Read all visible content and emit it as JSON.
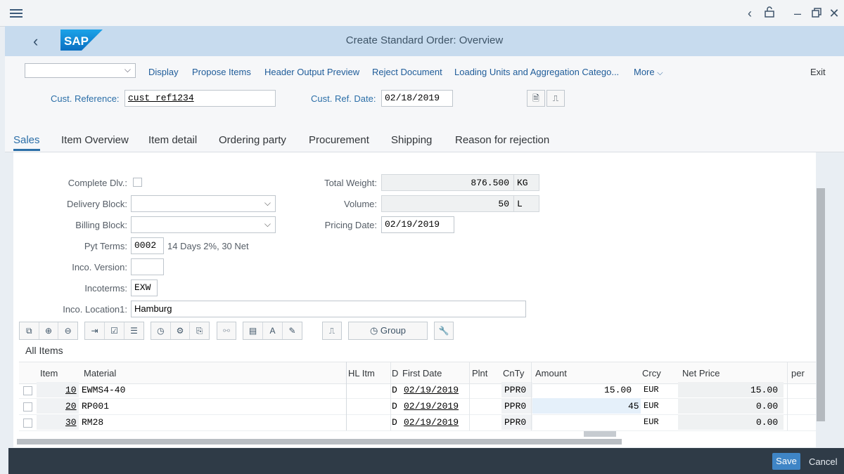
{
  "header": {
    "title": "Create Standard Order: Overview"
  },
  "toolbar": {
    "variant_value": "",
    "buttons": [
      "Display",
      "Propose Items",
      "Header Output Preview",
      "Reject Document",
      "Loading Units and Aggregation Catego...",
      "More"
    ],
    "exit": "Exit"
  },
  "reference": {
    "cust_ref_label": "Cust. Reference:",
    "cust_ref_value": "cust_ref1234",
    "cust_ref_date_label": "Cust. Ref. Date:",
    "cust_ref_date_value": "02/18/2019"
  },
  "tabs": [
    "Sales",
    "Item Overview",
    "Item detail",
    "Ordering party",
    "Procurement",
    "Shipping",
    "Reason for rejection"
  ],
  "sales": {
    "complete_dlv_label": "Complete Dlv.:",
    "delivery_block_label": "Delivery Block:",
    "delivery_block_value": "",
    "billing_block_label": "Billing Block:",
    "billing_block_value": "",
    "pyt_terms_label": "Pyt Terms:",
    "pyt_terms_value": "0002",
    "pyt_terms_desc": "14 Days 2%, 30 Net",
    "inco_version_label": "Inco. Version:",
    "inco_version_value": "",
    "incoterms_label": "Incoterms:",
    "incoterms_value": "EXW",
    "inco_location_label": "Inco. Location1:",
    "inco_location_value": "Hamburg",
    "total_weight_label": "Total Weight:",
    "total_weight_value": "876.500",
    "total_weight_unit": "KG",
    "volume_label": "Volume:",
    "volume_value": "50",
    "volume_unit": "L",
    "pricing_date_label": "Pricing Date:",
    "pricing_date_value": "02/19/2019"
  },
  "items_toolbar": {
    "group_label": "Group"
  },
  "items": {
    "title": "All Items",
    "columns": [
      "Item",
      "Material",
      "HL Itm",
      "D",
      "First Date",
      "Plnt",
      "CnTy",
      "Amount",
      "Crcy",
      "Net Price",
      "per"
    ],
    "rows": [
      {
        "item": "10",
        "material": "EWMS4-40",
        "hl_itm": "",
        "d": "D",
        "first_date": "02/19/2019",
        "plnt": "",
        "cnty": "PPR0",
        "amount": "15.00",
        "crcy": "EUR",
        "net_price": "15.00",
        "per": ""
      },
      {
        "item": "20",
        "material": "RP001",
        "hl_itm": "",
        "d": "D",
        "first_date": "02/19/2019",
        "plnt": "",
        "cnty": "PPR0",
        "amount": "45",
        "crcy": "EUR",
        "net_price": "0.00",
        "per": ""
      },
      {
        "item": "30",
        "material": "RM28",
        "hl_itm": "",
        "d": "D",
        "first_date": "02/19/2019",
        "plnt": "",
        "cnty": "PPR0",
        "amount": "",
        "crcy": "EUR",
        "net_price": "0.00",
        "per": ""
      }
    ]
  },
  "footer": {
    "save": "Save",
    "cancel": "Cancel"
  }
}
